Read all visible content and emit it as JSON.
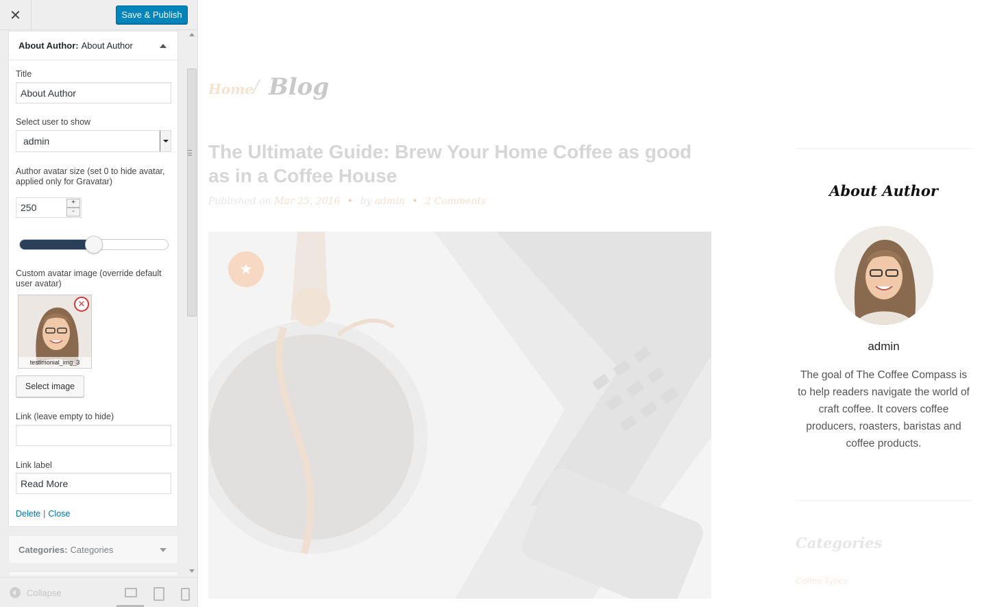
{
  "header": {
    "close_glyph": "✕",
    "publish_label": "Save & Publish"
  },
  "widget": {
    "title_bold": "About Author:",
    "title_sub": "About Author",
    "title_label": "Title",
    "title_value": "About Author",
    "user_label": "Select user to show",
    "user_value": "admin",
    "avatar_size_label": "Author avatar size (set 0 to hide avatar, applied only for Gravatar)",
    "avatar_size_value": "250",
    "stepper_plus": "+",
    "stepper_minus": "-",
    "avatar_size_slider_fraction": 0.5,
    "custom_avatar_label": "Custom avatar image (override default user avatar)",
    "image_caption": "testimonial_img_3",
    "remove_glyph": "✕",
    "select_image_label": "Select image",
    "link_label": "Link (leave empty to hide)",
    "link_value": "",
    "link_label_label": "Link label",
    "link_label_value": "Read More",
    "delete_label": "Delete",
    "separator": "|",
    "close_label": "Close"
  },
  "widget2": {
    "title_bold": "Categories:",
    "title_sub": "Categories"
  },
  "footer": {
    "collapse_label": "Collapse",
    "devices": [
      "desktop-icon",
      "tablet-icon",
      "mobile-icon"
    ]
  },
  "preview": {
    "breadcrumb_home": "Home",
    "breadcrumb_sep": "/",
    "breadcrumb_current": "Blog",
    "post_title": "The Ultimate Guide: Brew Your Home Coffee as good as in a Coffee House",
    "meta_published": "Published on",
    "meta_date": "Mar 25, 2016",
    "meta_by": "by",
    "meta_author": "admin",
    "meta_comments": "2 Comments",
    "meta_dot": "•",
    "featured_glyph": "★",
    "about_title": "About Author",
    "author_name": "admin",
    "author_bio": "The goal of The Coffee Compass is to help readers navigate the world of craft coffee. It covers coffee producers, roasters, baristas and coffee products.",
    "categories_title": "Categories",
    "categories_item": "Coffee Types"
  },
  "colors": {
    "primary_button": "#0085ba",
    "link": "#0073aa",
    "slider_fill": "#29405a",
    "remove_red": "#d63638"
  }
}
